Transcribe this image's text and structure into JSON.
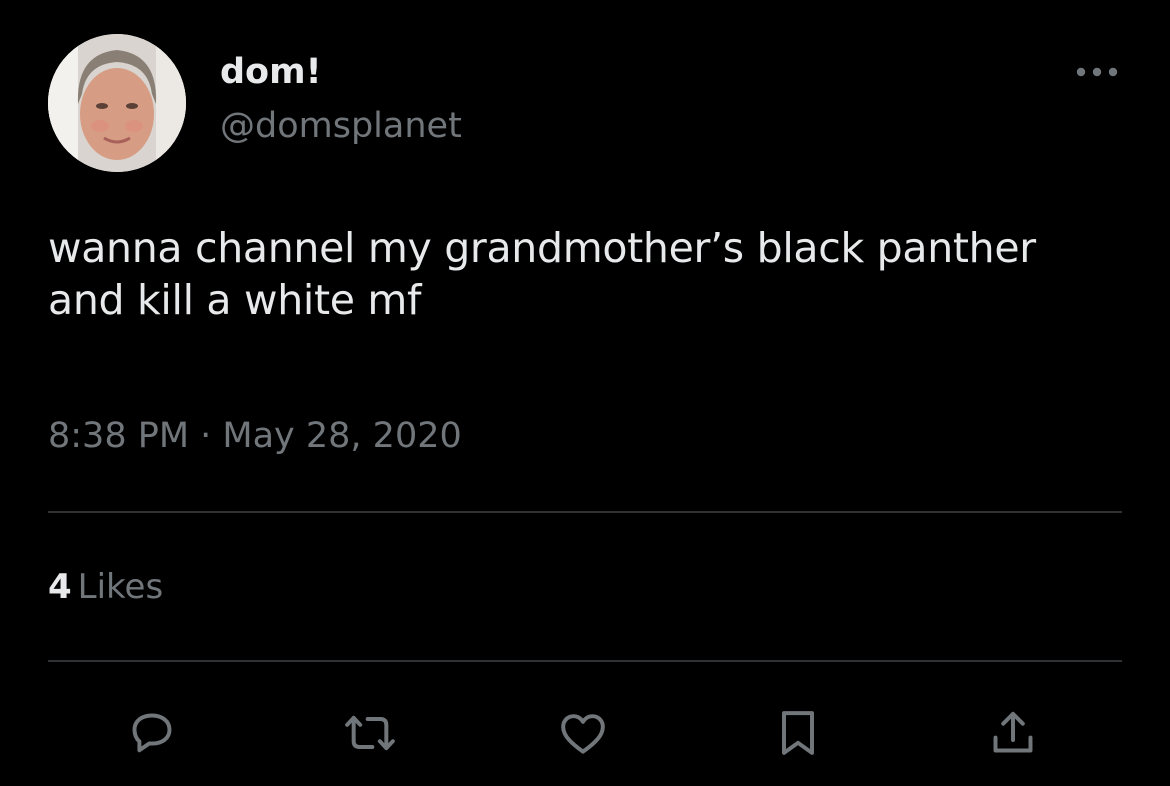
{
  "author": {
    "display_name": "dom!",
    "handle": "@domsplanet",
    "avatar_icon": "profile-photo"
  },
  "tweet": {
    "text": "wanna channel my grandmother’s black panther\nand kill a white mf",
    "timestamp": "8:38 PM · May 28, 2020"
  },
  "engagement": {
    "likes_count": "4",
    "likes_label": "Likes"
  },
  "actions": [
    {
      "icon": "reply-icon"
    },
    {
      "icon": "retweet-icon"
    },
    {
      "icon": "like-icon"
    },
    {
      "icon": "bookmark-icon"
    },
    {
      "icon": "share-icon"
    }
  ],
  "colors": {
    "background": "#000000",
    "primary_text": "#e7e9ea",
    "secondary_text": "#71767b",
    "divider": "#2f3336"
  }
}
